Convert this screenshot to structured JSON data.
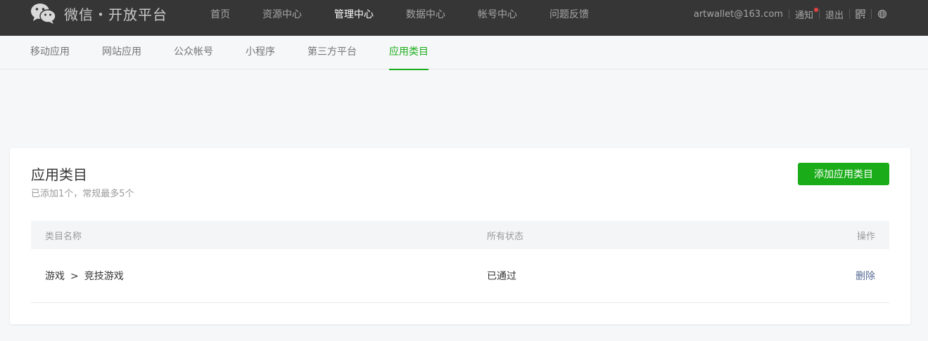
{
  "brand": {
    "name": "微信・开放平台"
  },
  "main_nav": [
    {
      "label": "首页",
      "active": false
    },
    {
      "label": "资源中心",
      "active": false
    },
    {
      "label": "管理中心",
      "active": true
    },
    {
      "label": "数据中心",
      "active": false
    },
    {
      "label": "帐号中心",
      "active": false
    },
    {
      "label": "问题反馈",
      "active": false
    }
  ],
  "user": {
    "email": "artwallet@163.com",
    "notice_label": "通知",
    "logout_label": "退出",
    "icons": [
      "qrcode-icon",
      "globe-icon"
    ]
  },
  "sub_nav": [
    {
      "label": "移动应用",
      "active": false
    },
    {
      "label": "网站应用",
      "active": false
    },
    {
      "label": "公众帐号",
      "active": false
    },
    {
      "label": "小程序",
      "active": false
    },
    {
      "label": "第三方平台",
      "active": false
    },
    {
      "label": "应用类目",
      "active": true
    }
  ],
  "panel": {
    "title": "应用类目",
    "description": "已添加1个，常规最多5个",
    "add_button_label": "添加应用类目",
    "table": {
      "headers": {
        "name": "类目名称",
        "status": "所有状态",
        "op": "操作"
      },
      "rows": [
        {
          "category": "游戏",
          "separator": ">",
          "subcategory": "竞技游戏",
          "status": "已通过",
          "action": "删除"
        }
      ]
    }
  },
  "colors": {
    "header_bg": "#363636",
    "accent_green": "#1aad19",
    "link": "#576b95",
    "notice_dot": "#e64340",
    "page_bg": "#f6f7f9"
  }
}
